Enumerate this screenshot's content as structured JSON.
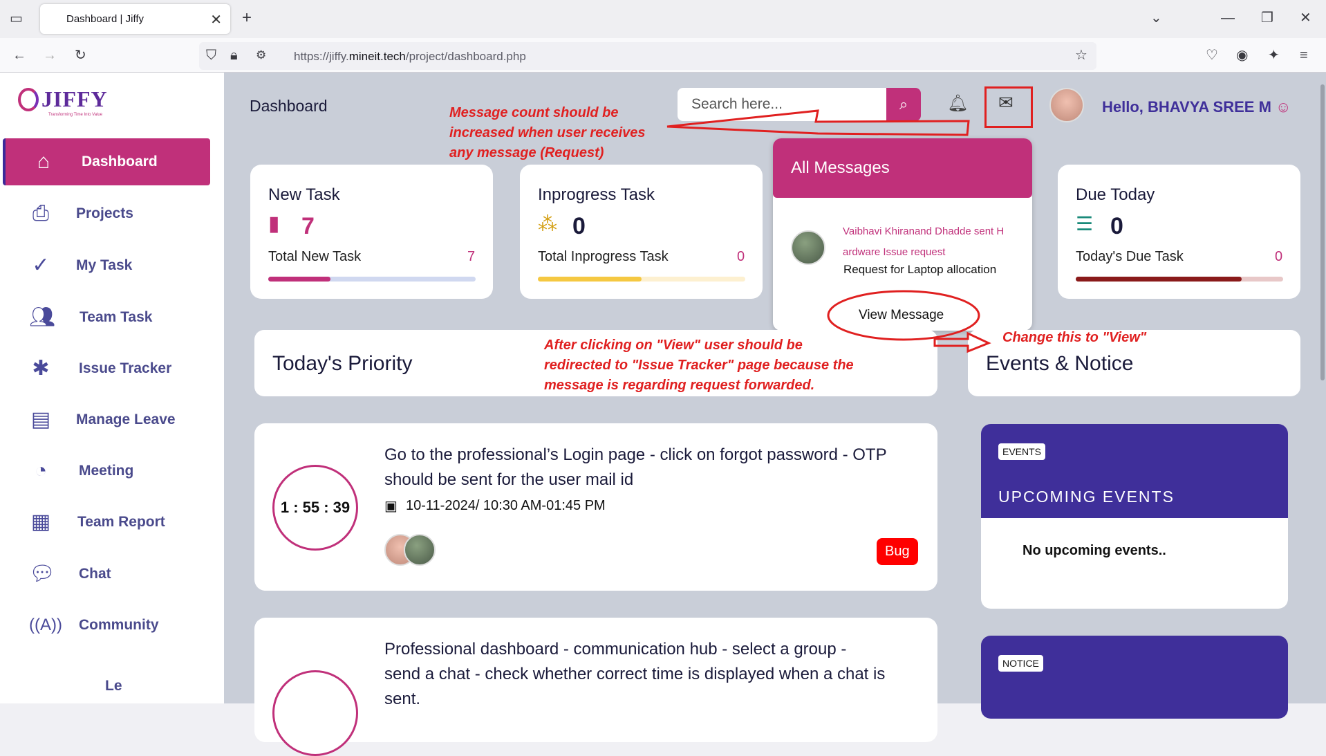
{
  "browser": {
    "tab_title": "Dashboard | Jiffy",
    "url_prefix": "https://jiffy.",
    "url_domain": "mineit.tech",
    "url_path": "/project/dashboard.php"
  },
  "logo": {
    "name": "JIFFY",
    "tagline": "Transforming Time Into Value"
  },
  "sidebar": {
    "items": [
      {
        "label": "Dashboard",
        "icon": "home-icon"
      },
      {
        "label": "Projects",
        "icon": "printer-icon"
      },
      {
        "label": "My Task",
        "icon": "check-circle-icon"
      },
      {
        "label": "Team Task",
        "icon": "users-icon"
      },
      {
        "label": "Issue Tracker",
        "icon": "bug-icon"
      },
      {
        "label": "Manage Leave",
        "icon": "document-icon"
      },
      {
        "label": "Meeting",
        "icon": "clock-icon"
      },
      {
        "label": "Team Report",
        "icon": "grid-icon"
      },
      {
        "label": "Chat",
        "icon": "chat-icon"
      },
      {
        "label": "Community",
        "icon": "broadcast-icon"
      },
      {
        "label": "Le",
        "icon": ""
      }
    ]
  },
  "header": {
    "title": "Dashboard",
    "search_placeholder": "Search here...",
    "greeting": "Hello, BHAVYA SREE M"
  },
  "cards": {
    "new_task": {
      "title": "New Task",
      "count": "7",
      "label": "Total New Task",
      "value": "7"
    },
    "inprogress": {
      "title": "Inprogress Task",
      "count": "0",
      "label": "Total Inprogress Task",
      "value": "0"
    },
    "due_today": {
      "title": "Due Today",
      "count": "0",
      "label": "Today's Due Task",
      "value": "0"
    }
  },
  "messages": {
    "header": "All Messages",
    "sender": "Vaibhavi Khiranand Dhadde sent H",
    "sender2": "ardware Issue request",
    "body": "Request for Laptop allocation",
    "view_label": "View Message"
  },
  "priority": {
    "title": "Today's  Priority"
  },
  "events_notice": {
    "title": "Events & Notice"
  },
  "tasks": [
    {
      "line1": "Go to the professional’s Login page - click on forgot password - OTP",
      "line2": "should be sent for the user mail id",
      "timer": "1 : 55 : 39",
      "date": "10-11-2024/ 10:30 AM-01:45 PM",
      "tag": "Bug"
    },
    {
      "line1": "Professional dashboard - communication hub - select a group -",
      "line2": "send a chat - check whether correct time is displayed when a chat is",
      "line3": "sent."
    }
  ],
  "events": {
    "badge": "EVENTS",
    "title": "UPCOMING  EVENTS",
    "empty": "No upcoming events.."
  },
  "notice": {
    "badge": "NOTICE"
  },
  "annotations": {
    "a1_l1": "Message count should be",
    "a1_l2": "increased when user receives",
    "a1_l3": "any message (Request)",
    "a2_l1": "After clicking on \"View\" user should be",
    "a2_l2": "redirected to \"Issue Tracker\" page because the",
    "a2_l3": "message is regarding request forwarded.",
    "a3": "Change this to \"View\""
  },
  "colors": {
    "brand": "#c0307a",
    "purple": "#3f2f9a",
    "annotation": "#e02020"
  }
}
